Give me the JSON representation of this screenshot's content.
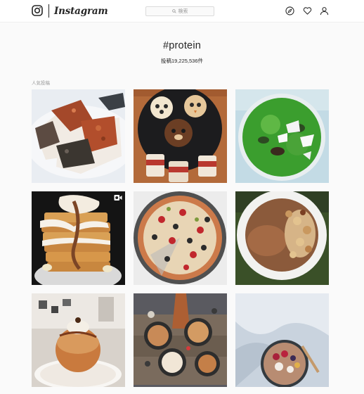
{
  "header": {
    "brand": "Instagram",
    "search_placeholder": "検索",
    "icons": [
      "instagram-glyph-icon",
      "compass-icon",
      "heart-icon",
      "user-icon"
    ]
  },
  "tag": {
    "name": "#protein",
    "posts": "投稿19,225,536件"
  },
  "section": {
    "title": "人気投稿"
  },
  "posts": [
    {
      "subject": "seared fish with seasoning",
      "video": false
    },
    {
      "subject": "animal face pancakes with protein cream jars",
      "video": false
    },
    {
      "subject": "green smoothie bowl with coconut and kiwi",
      "video": false
    },
    {
      "subject": "waffle tower with cream and banana",
      "video": true
    },
    {
      "subject": "pizza on dark pan",
      "video": false
    },
    {
      "subject": "chocolate pudding with granola",
      "video": false
    },
    {
      "subject": "baked apple on doily",
      "video": false
    },
    {
      "subject": "mini cakes on wooden board",
      "video": false
    },
    {
      "subject": "smoothie bowl with berries",
      "video": false
    }
  ]
}
